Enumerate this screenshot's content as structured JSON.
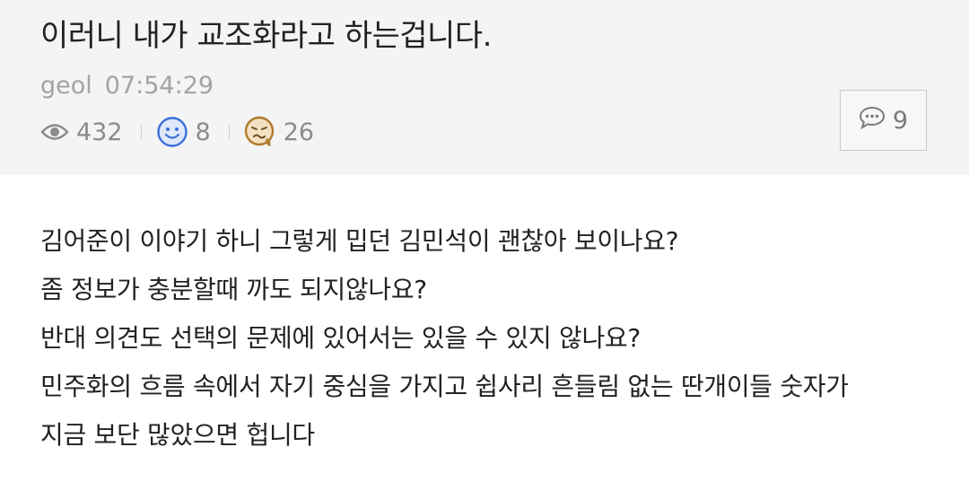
{
  "post": {
    "title": "이러니 내가 교조화라고 하는겁니다.",
    "author": "geol",
    "time": "07:54:29"
  },
  "stats": {
    "views": "432",
    "likes": "8",
    "dislikes": "26",
    "icons": {
      "views": "eye-icon",
      "likes": "smiley-icon",
      "dislikes": "sick-face-icon"
    },
    "colors": {
      "like": "#3a6fd8",
      "dislike": "#b07a2a"
    }
  },
  "comments": {
    "count": "9",
    "icon": "speech-bubble-icon"
  },
  "content": {
    "lines": [
      "김어준이 이야기 하니 그렇게 밉던 김민석이 괜찮아 보이나요?",
      "좀 정보가 충분할때 까도 되지않나요?",
      "반대 의견도 선택의 문제에 있어서는 있을 수 있지 않나요?",
      "민주화의 흐름 속에서 자기 중심을 가지고 쉽사리 흔들림 없는 딴개이들 숫자가",
      "지금 보단 많았으면 헙니다"
    ]
  }
}
